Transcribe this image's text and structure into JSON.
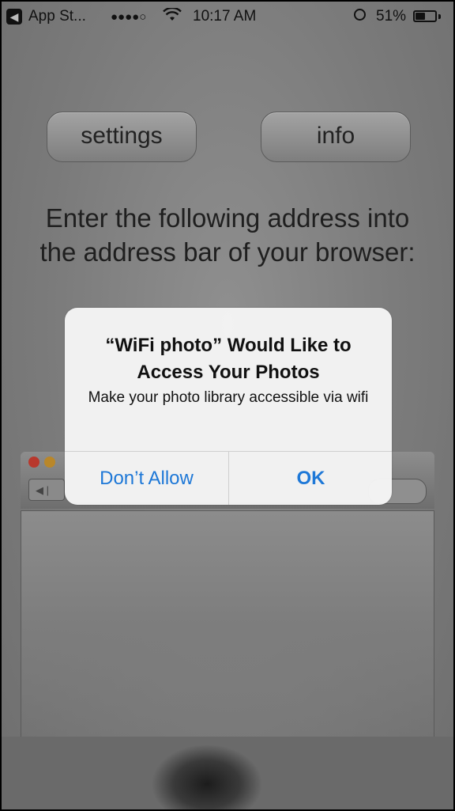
{
  "status_bar": {
    "back_label": "App St...",
    "signal": "●●●●○",
    "time": "10:17 AM",
    "battery_percent": "51%",
    "battery_level": 0.51,
    "icons": [
      "back-arrow-icon",
      "wifi-icon",
      "alarm-icon",
      "battery-icon"
    ]
  },
  "toolbar": {
    "settings_label": "settings",
    "info_label": "info"
  },
  "main": {
    "instructions": "Enter the following address into the address bar of your browser:"
  },
  "alert": {
    "title": "“WiFi photo” Would Like to Access Your Photos",
    "message": "Make your photo library accessible via wifi",
    "cancel_label": "Don’t Allow",
    "ok_label": "OK"
  },
  "colors": {
    "accent": "#1e78d7",
    "background": "#7b7b7b"
  }
}
